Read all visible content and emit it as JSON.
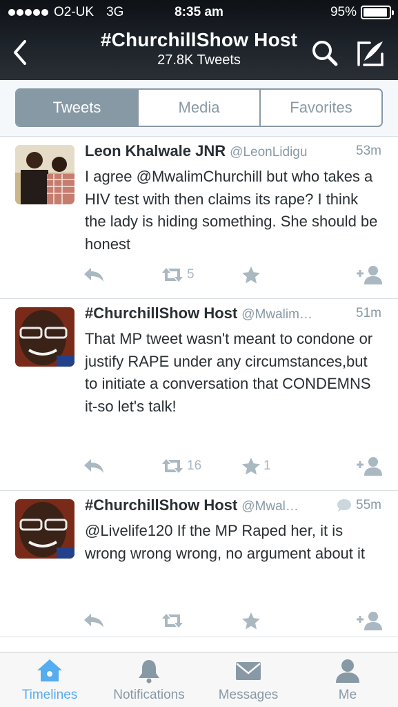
{
  "status_bar": {
    "carrier": "O2-UK",
    "network": "3G",
    "time": "8:35 am",
    "battery": "95%",
    "battery_level": 0.95
  },
  "header": {
    "title": "#ChurchillShow Host",
    "subtitle": "27.8K Tweets"
  },
  "segments": [
    {
      "label": "Tweets",
      "active": true
    },
    {
      "label": "Media",
      "active": false
    },
    {
      "label": "Favorites",
      "active": false
    }
  ],
  "tweets": [
    {
      "name": "Leon Khalwale JNR",
      "handle": "@LeonLidigu",
      "time": "53m",
      "text": "I agree @MwalimChurchill but who takes a HIV test with then claims its rape? I think the lady is hiding something. She should be honest",
      "retweets": "5",
      "favorites": ""
    },
    {
      "name": "#ChurchillShow Host",
      "handle": "@Mwalim…",
      "time": "51m",
      "text": "That MP tweet wasn't meant to condone or justify RAPE under any circumstances,but to initiate a conversation that CONDEMNS it-so let's talk!",
      "retweets": "16",
      "favorites": "1"
    },
    {
      "name": "#ChurchillShow Host",
      "handle": "@Mwal…",
      "time": "55m",
      "text": "@Livelife120 If the MP Raped her, it is wrong wrong wrong, no argument about it",
      "retweets": "",
      "favorites": "",
      "is_reply": true
    }
  ],
  "tabbar": [
    {
      "label": "Timelines",
      "icon": "home-icon",
      "active": true
    },
    {
      "label": "Notifications",
      "icon": "bell-icon",
      "active": false
    },
    {
      "label": "Messages",
      "icon": "envelope-icon",
      "active": false
    },
    {
      "label": "Me",
      "icon": "person-icon",
      "active": false
    }
  ],
  "colors": {
    "accent": "#55acee",
    "muted": "#8899a6",
    "icon_gray": "#aab8c2",
    "text": "#292f33"
  }
}
